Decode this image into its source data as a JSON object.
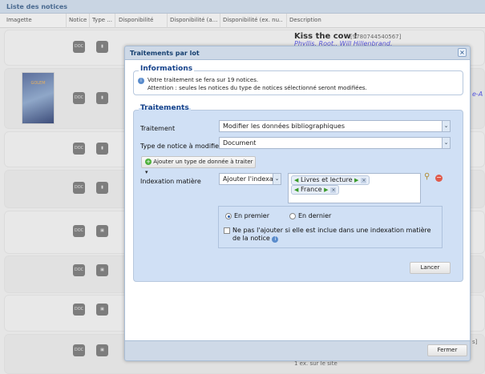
{
  "panel": {
    "title": "Liste des notices"
  },
  "columns": [
    "Imagette",
    "Notice",
    "Type ...",
    "Disponibilité",
    "Disponibilité (a...",
    "Disponibilité (ex. nu...",
    "Description"
  ],
  "background": {
    "first_title": "Kiss the cow !",
    "first_isbn": "[9780744540567]",
    "first_authors": "Phyllis, Root., Will Hillenbrand.",
    "cover_title": "GOLEM",
    "fragment_link": "e-A",
    "fragment_right": "s]",
    "last_availability": "1 ex. sur le site"
  },
  "dialog": {
    "title": "Traitements par lot",
    "close": "×",
    "info": {
      "legend": "Informations",
      "line1": "Votre traitement se fera sur 19 notices.",
      "line2": "Attention : seules les notices du type de notices sélectionné seront modifiées."
    },
    "traitements": {
      "legend": "Traitements",
      "traitement_label": "Traitement",
      "traitement_value": "Modifier les données bibliographiques",
      "type_label": "Type de notice à modifier",
      "type_value": "Document",
      "add_button": "Ajouter un type de donnée à traiter",
      "index_label": "Indexation matière",
      "index_mode": "Ajouter l'indexatio",
      "tags": [
        "Livres et lecture",
        "France"
      ],
      "radio_first": "En premier",
      "radio_last": "En dernier",
      "radio_selected": "first",
      "checkbox_label": "Ne pas l'ajouter si elle est inclue dans une indexation matière de la notice",
      "checkbox_checked": false,
      "run_button": "Lancer"
    },
    "close_button": "Fermer"
  }
}
